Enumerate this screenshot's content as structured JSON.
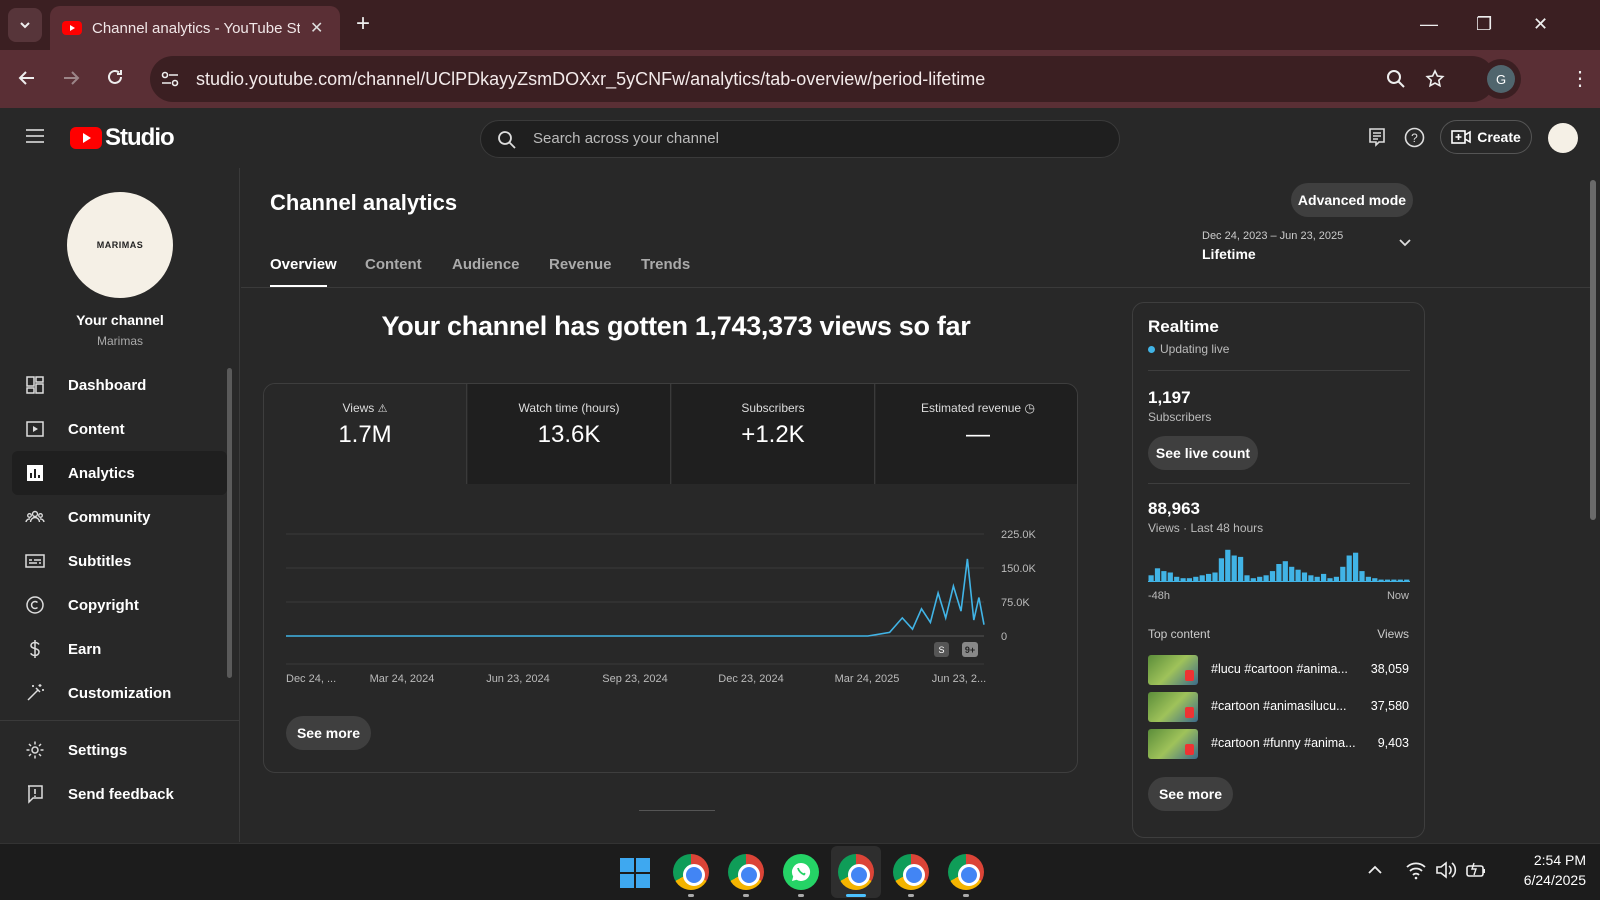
{
  "browser": {
    "tab_title": "Channel analytics - YouTube Studio",
    "url": "studio.youtube.com/channel/UClPDkayyZsmDOXxr_5yCNFw/analytics/tab-overview/period-lifetime",
    "profile_initial": "G"
  },
  "header": {
    "logo_text": "Studio",
    "search_placeholder": "Search across your channel",
    "create_label": "Create"
  },
  "sidebar": {
    "avatar_text": "MARIMAS",
    "channel_label": "Your channel",
    "channel_name": "Marimas",
    "items": [
      {
        "label": "Dashboard"
      },
      {
        "label": "Content"
      },
      {
        "label": "Analytics"
      },
      {
        "label": "Community"
      },
      {
        "label": "Subtitles"
      },
      {
        "label": "Copyright"
      },
      {
        "label": "Earn"
      },
      {
        "label": "Customization"
      }
    ],
    "bottom_items": [
      {
        "label": "Settings"
      },
      {
        "label": "Send feedback"
      }
    ]
  },
  "main": {
    "page_title": "Channel analytics",
    "advanced_mode_label": "Advanced mode",
    "tabs": [
      {
        "label": "Overview"
      },
      {
        "label": "Content"
      },
      {
        "label": "Audience"
      },
      {
        "label": "Revenue"
      },
      {
        "label": "Trends"
      }
    ],
    "date_range": "Dec 24, 2023 – Jun 23, 2025",
    "period_label": "Lifetime",
    "headline": "Your channel has gotten 1,743,373 views so far",
    "metrics": [
      {
        "label": "Views",
        "value": "1.7M"
      },
      {
        "label": "Watch time (hours)",
        "value": "13.6K"
      },
      {
        "label": "Subscribers",
        "value": "+1.2K"
      },
      {
        "label": "Estimated revenue",
        "value": "—"
      }
    ],
    "see_more_label": "See more",
    "badge_label": "9+"
  },
  "chart_data": {
    "type": "line",
    "series": [
      {
        "values_x": [
          "2023-12-24",
          "2024-03-24",
          "2024-06-23",
          "2024-09-23",
          "2024-12-23",
          "2025-03-24",
          "2025-04-10",
          "2025-04-20",
          "2025-04-28",
          "2025-05-05",
          "2025-05-12",
          "2025-05-18",
          "2025-05-24",
          "2025-05-30",
          "2025-06-05",
          "2025-06-10",
          "2025-06-15",
          "2025-06-19",
          "2025-06-23"
        ],
        "values_y": [
          0,
          0,
          0,
          0,
          0,
          0,
          8000,
          40000,
          15000,
          60000,
          30000,
          95000,
          40000,
          110000,
          55000,
          170000,
          35000,
          85000,
          25000
        ]
      }
    ],
    "x_tick_labels": [
      "Dec 24, ...",
      "Mar 24, 2024",
      "Jun 23, 2024",
      "Sep 23, 2024",
      "Dec 23, 2024",
      "Mar 24, 2025",
      "Jun 23, 2..."
    ],
    "y_tick_labels": [
      "225.0K",
      "150.0K",
      "75.0K",
      "0"
    ],
    "ylim": [
      0,
      225000
    ],
    "grid": true,
    "line_color": "#41b4e6"
  },
  "realtime": {
    "title": "Realtime",
    "status": "Updating live",
    "subscribers_value": "1,197",
    "subscribers_label": "Subscribers",
    "see_live_label": "See live count",
    "views_value": "88,963",
    "views_label": "Views · Last 48 hours",
    "axis_start": "-48h",
    "axis_end": "Now",
    "bars": [
      4,
      9,
      7,
      6,
      3,
      2,
      2,
      3,
      4,
      5,
      6,
      16,
      22,
      18,
      17,
      4,
      2,
      3,
      4,
      7,
      12,
      14,
      10,
      8,
      6,
      4,
      3,
      5,
      2,
      3,
      10,
      18,
      20,
      7,
      3,
      2,
      1,
      1,
      1,
      1,
      1
    ],
    "top_content_label": "Top content",
    "top_content_views_label": "Views",
    "top_content": [
      {
        "title": "#lucu #cartoon #anima...",
        "views": "38,059"
      },
      {
        "title": "#cartoon #animasilucu...",
        "views": "37,580"
      },
      {
        "title": "#cartoon #funny #anima...",
        "views": "9,403"
      }
    ],
    "see_more_label": "See more",
    "accent": "#41b4e6"
  },
  "taskbar": {
    "time": "2:54 PM",
    "date": "6/24/2025"
  }
}
